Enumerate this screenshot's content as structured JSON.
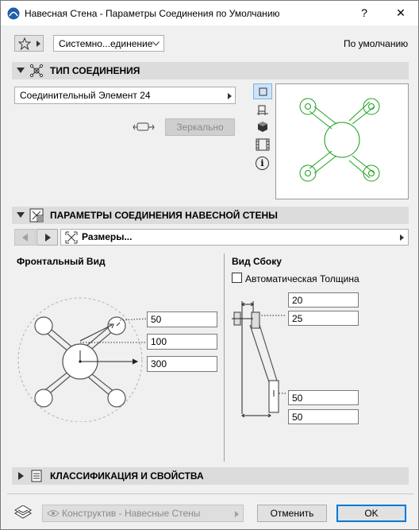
{
  "window": {
    "title": "Навесная Стена - Параметры Соединения по Умолчанию",
    "help_label": "?",
    "close_label": "✕"
  },
  "top": {
    "favorites_icon": "star-icon",
    "preset_value": "Системно...единение",
    "default_label": "По умолчанию"
  },
  "joint_type": {
    "title": "ТИП СОЕДИНЕНИЯ",
    "element_value": "Соединительный Элемент 24",
    "mirror_label": "Зеркально",
    "view_icons": [
      "square-icon",
      "plan-icon",
      "cube-icon",
      "film-icon",
      "info-icon"
    ],
    "info_glyph": "i"
  },
  "joint_params": {
    "title": "ПАРАМЕТРЫ СОЕДИНЕНИЯ НАВЕСНОЙ СТЕНЫ",
    "page_value": "Размеры...",
    "front_view_label": "Фронтальный Вид",
    "side_view_label": "Вид Сбоку",
    "auto_thickness_label": "Автоматическая Толщина",
    "auto_thickness_checked": false,
    "front_values": [
      "50",
      "100",
      "300"
    ],
    "side_values_top": [
      "20",
      "25"
    ],
    "side_values_bottom": [
      "50",
      "50"
    ]
  },
  "classification": {
    "title": "КЛАССИФИКАЦИЯ И СВОЙСТВА"
  },
  "footer": {
    "layer_value": "Конструктив - Навесные Стены",
    "cancel_label": "Отменить",
    "ok_label": "OK"
  },
  "colors": {
    "accent": "#0078d7",
    "preview_green": "#1ca01c",
    "section_bg": "#dcdcdc"
  }
}
